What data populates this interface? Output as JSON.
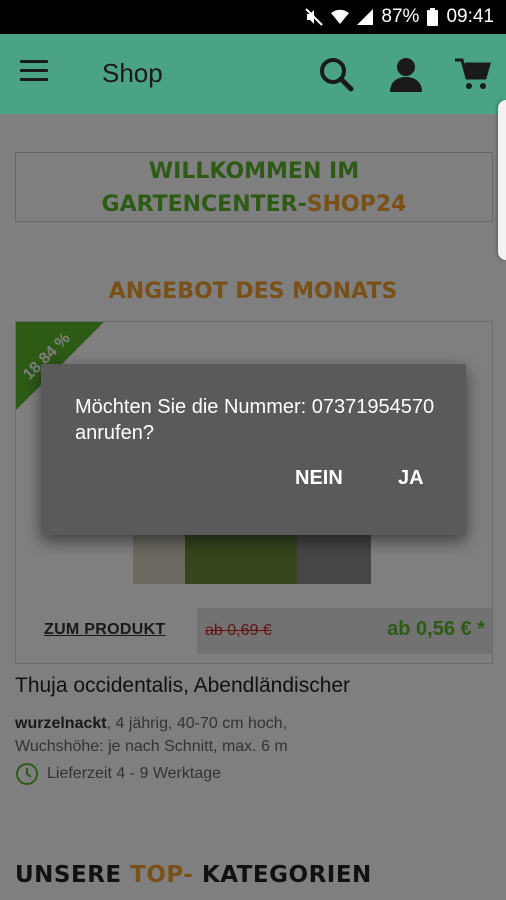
{
  "status_bar": {
    "battery": "87%",
    "time": "09:41",
    "icons": [
      "mute-icon",
      "wifi-icon",
      "signal-icon",
      "battery-icon"
    ]
  },
  "app_bar": {
    "title": "Shop",
    "icons": [
      "menu-icon",
      "search-icon",
      "account-icon",
      "cart-icon"
    ],
    "color": "#4aa383"
  },
  "welcome": {
    "line1": "WILLKOMMEN IM",
    "line2_a": "GARTENCENTER-",
    "line2_b": "SHOP24"
  },
  "offer_heading": "ANGEBOT DES MONATS",
  "product": {
    "discount_badge": "18,84 %",
    "to_product_label": "ZUM PRODUKT",
    "old_price": "ab 0,69 €",
    "new_price": "ab 0,56 € *",
    "name": "Thuja occidentalis, Abendländischer",
    "desc_bold": "wurzelnackt",
    "desc_rest": ", 4 jährig, 40-70 cm hoch,",
    "desc_line2": "Wuchshöhe: je nach Schnitt, max. 6 m",
    "delivery": "Lieferzeit 4 - 9 Werktage"
  },
  "categories_heading": {
    "part1": "UNSERE ",
    "part2": "TOP-",
    "part3": " KATEGORIEN"
  },
  "dialog": {
    "message": "Möchten Sie die Nummer: 07371954570 anrufen?",
    "no_label": "NEIN",
    "yes_label": "JA"
  },
  "colors": {
    "accent_green": "#5ab52a",
    "accent_orange": "#f0a030",
    "price_red": "#cc2222"
  }
}
